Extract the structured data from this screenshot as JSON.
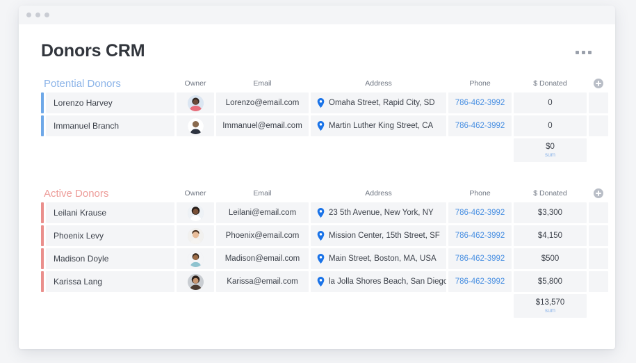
{
  "window": {
    "dots": [
      "dot",
      "dot",
      "dot"
    ]
  },
  "header": {
    "title": "Donors CRM",
    "menu_icon": "kebab-menu-icon"
  },
  "columns": [
    "Owner",
    "Email",
    "Address",
    "Phone",
    "$ Donated"
  ],
  "add_column_icon": "plus-circle-icon",
  "colors": {
    "potential_accent": "#6ea8e8",
    "potential_title": "#8cb4e8",
    "active_accent": "#ea8f8c",
    "active_title": "#ed9c99",
    "phone_link": "#4a90e2",
    "cell_bg": "#f4f5f7",
    "pin": "#1a73e8"
  },
  "sections": [
    {
      "id": "potential-donors",
      "title": "Potential Donors",
      "rows": [
        {
          "name": "Lorenzo Harvey",
          "avatar": "avatar-lorenzo",
          "email": "Lorenzo@email.com",
          "address": "Omaha Street, Rapid City, SD",
          "phone": "786-462-3992",
          "donated": "0"
        },
        {
          "name": "Immanuel Branch",
          "avatar": "avatar-immanuel",
          "email": "Immanuel@email.com",
          "address": "Martin Luther King Street, CA",
          "phone": "786-462-3992",
          "donated": "0"
        }
      ],
      "sum_value": "$0",
      "sum_label": "sum"
    },
    {
      "id": "active-donors",
      "title": "Active Donors",
      "rows": [
        {
          "name": "Leilani Krause",
          "avatar": "avatar-leilani",
          "email": "Leilani@email.com",
          "address": "23 5th Avenue, New York, NY",
          "phone": "786-462-3992",
          "donated": "$3,300"
        },
        {
          "name": "Phoenix Levy",
          "avatar": "avatar-phoenix",
          "email": "Phoenix@email.com",
          "address": "Mission Center, 15th Street, SF",
          "phone": "786-462-3992",
          "donated": "$4,150"
        },
        {
          "name": "Madison Doyle",
          "avatar": "avatar-madison",
          "email": "Madison@email.com",
          "address": "Main Street, Boston, MA, USA",
          "phone": "786-462-3992",
          "donated": "$500"
        },
        {
          "name": "Karissa Lang",
          "avatar": "avatar-karissa",
          "email": "Karissa@email.com",
          "address": "la Jolla Shores Beach, San Diego",
          "phone": "786-462-3992",
          "donated": "$5,800"
        }
      ],
      "sum_value": "$13,570",
      "sum_label": "sum"
    }
  ]
}
